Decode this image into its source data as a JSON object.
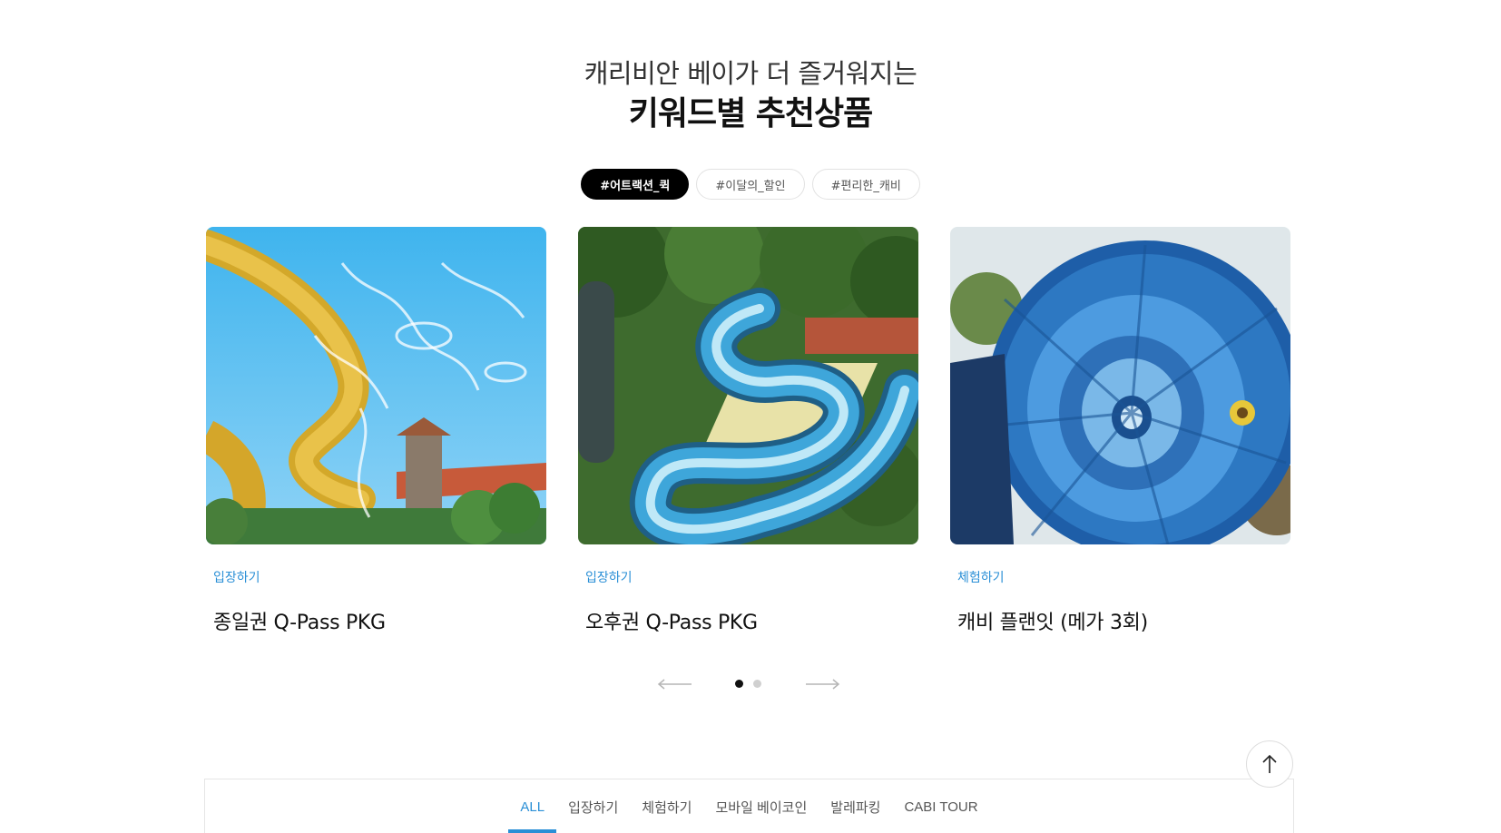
{
  "heading": {
    "subtitle": "캐리비안 베이가 더 즐거워지는",
    "title": "키워드별 추천상품"
  },
  "keyword_tabs": [
    {
      "label": "#어트랙션_퀵",
      "active": true
    },
    {
      "label": "#이달의_할인",
      "active": false
    },
    {
      "label": "#편리한_캐비",
      "active": false
    }
  ],
  "cards": [
    {
      "category": "입장하기",
      "title": "종일권 Q-Pass PKG",
      "image": "yellow water slide splash photo"
    },
    {
      "category": "입장하기",
      "title": "오후권 Q-Pass PKG",
      "image": "winding blue water slide photo"
    },
    {
      "category": "체험하기",
      "title": "캐비 플랜잇 (메가 3회)",
      "image": "blue funnel water slide photo"
    }
  ],
  "slider": {
    "prev_icon": "arrow-left-icon",
    "next_icon": "arrow-right-icon",
    "pages": 2,
    "current_page": 1
  },
  "top_button": {
    "icon": "arrow-up-icon"
  },
  "bottom_tabs": [
    {
      "label": "ALL",
      "active": true
    },
    {
      "label": "입장하기",
      "active": false
    },
    {
      "label": "체험하기",
      "active": false
    },
    {
      "label": "모바일 베이코인",
      "active": false
    },
    {
      "label": "발레파킹",
      "active": false
    },
    {
      "label": "CABI TOUR",
      "active": false
    }
  ],
  "colors": {
    "accent": "#2a8fd6",
    "active_tab_bg": "#000000",
    "dot_active": "#111111",
    "dot_inactive": "#d0d0d0"
  }
}
